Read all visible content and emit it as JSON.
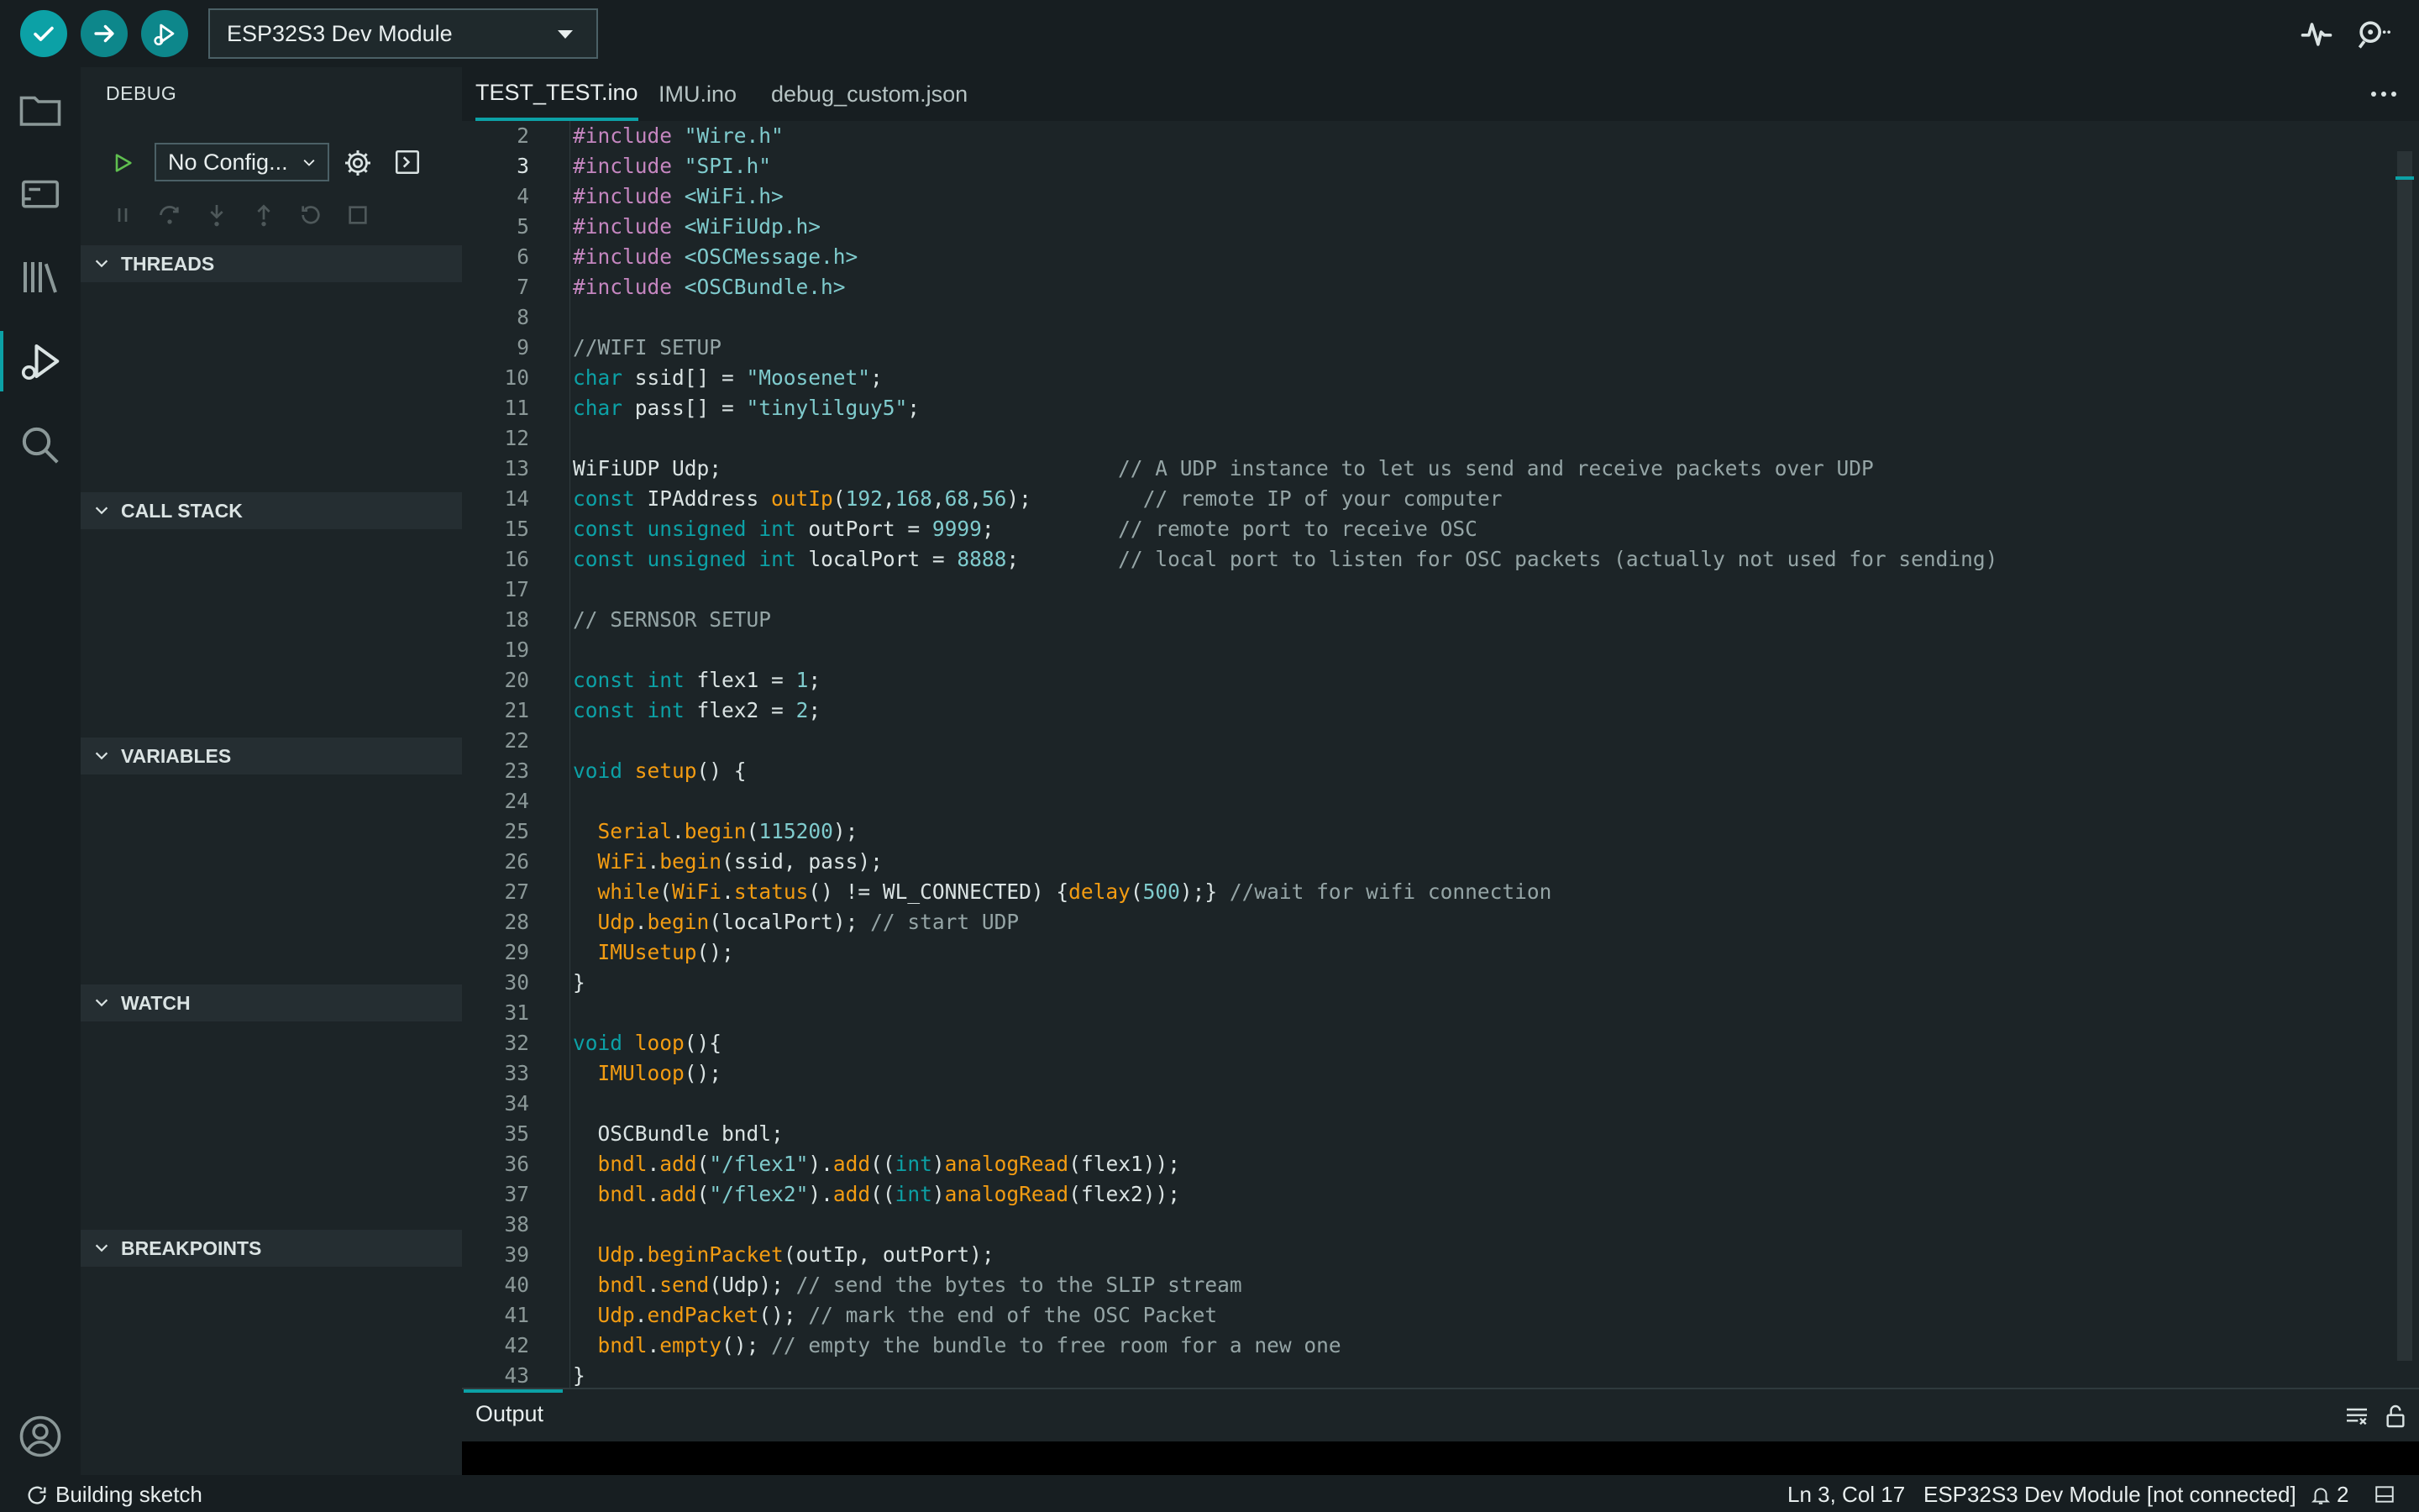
{
  "toolbar": {
    "board": "ESP32S3 Dev Module"
  },
  "sidebar": {
    "title": "DEBUG",
    "config": "No Config...",
    "sections": [
      "THREADS",
      "CALL STACK",
      "VARIABLES",
      "WATCH",
      "BREAKPOINTS"
    ]
  },
  "tabs": [
    "TEST_TEST.ino",
    "IMU.ino",
    "debug_custom.json"
  ],
  "editor": {
    "current_line": 3,
    "lines": [
      {
        "n": "2",
        "html": "<span class=\"p\">#include</span> <span class=\"s\">\"Wire.h\"</span>"
      },
      {
        "n": "3",
        "html": "<span class=\"p\">#include</span> <span class=\"s\">\"SPI.h\"</span>"
      },
      {
        "n": "4",
        "html": "<span class=\"p\">#include</span> <span class=\"s\">&lt;WiFi.h&gt;</span>"
      },
      {
        "n": "5",
        "html": "<span class=\"p\">#include</span> <span class=\"s\">&lt;WiFiUdp.h&gt;</span>"
      },
      {
        "n": "6",
        "html": "<span class=\"p\">#include</span> <span class=\"s\">&lt;OSCMessage.h&gt;</span>"
      },
      {
        "n": "7",
        "html": "<span class=\"p\">#include</span> <span class=\"s\">&lt;OSCBundle.h&gt;</span>"
      },
      {
        "n": "8",
        "html": ""
      },
      {
        "n": "9",
        "html": "<span class=\"c\">//WIFI SETUP</span>"
      },
      {
        "n": "10",
        "html": "<span class=\"k\">char</span> ssid[] = <span class=\"s\">\"Moosenet\"</span>;"
      },
      {
        "n": "11",
        "html": "<span class=\"k\">char</span> pass[] = <span class=\"s\">\"tinylilguy5\"</span>;"
      },
      {
        "n": "12",
        "html": ""
      },
      {
        "n": "13",
        "html": "WiFiUDP Udp;                                <span class=\"c\">// A UDP instance to let us send and receive packets over UDP</span>"
      },
      {
        "n": "14",
        "html": "<span class=\"k\">const</span> IPAddress <span class=\"fo\">outIp</span>(<span class=\"n\">192</span>,<span class=\"n\">168</span>,<span class=\"n\">68</span>,<span class=\"n\">56</span>);         <span class=\"c\">// remote IP of your computer</span>"
      },
      {
        "n": "15",
        "html": "<span class=\"k\">const</span> <span class=\"k\">unsigned</span> <span class=\"k\">int</span> outPort = <span class=\"n\">9999</span>;          <span class=\"c\">// remote port to receive OSC</span>"
      },
      {
        "n": "16",
        "html": "<span class=\"k\">const</span> <span class=\"k\">unsigned</span> <span class=\"k\">int</span> localPort = <span class=\"n\">8888</span>;        <span class=\"c\">// local port to listen for OSC packets (actually not used for sending)</span>"
      },
      {
        "n": "17",
        "html": ""
      },
      {
        "n": "18",
        "html": "<span class=\"c\">// SERNSOR SETUP</span>"
      },
      {
        "n": "19",
        "html": ""
      },
      {
        "n": "20",
        "html": "<span class=\"k\">const</span> <span class=\"k\">int</span> flex1 = <span class=\"n\">1</span>;"
      },
      {
        "n": "21",
        "html": "<span class=\"k\">const</span> <span class=\"k\">int</span> flex2 = <span class=\"n\">2</span>;"
      },
      {
        "n": "22",
        "html": ""
      },
      {
        "n": "23",
        "html": "<span class=\"k\">void</span> <span class=\"fo\">setup</span>() {"
      },
      {
        "n": "24",
        "html": ""
      },
      {
        "n": "25",
        "html": "  <span class=\"fo\">Serial</span>.<span class=\"fo\">begin</span>(<span class=\"n\">115200</span>);"
      },
      {
        "n": "26",
        "html": "  <span class=\"fo\">WiFi</span>.<span class=\"fo\">begin</span>(ssid, pass);"
      },
      {
        "n": "27",
        "html": "  <span class=\"fo\">while</span>(<span class=\"fo\">WiFi</span>.<span class=\"fo\">status</span>() != WL_CONNECTED) {<span class=\"fo\">delay</span>(<span class=\"n\">500</span>);} <span class=\"c\">//wait for wifi connection</span>"
      },
      {
        "n": "28",
        "html": "  <span class=\"fo\">Udp</span>.<span class=\"fo\">begin</span>(localPort); <span class=\"c\">// start UDP</span>"
      },
      {
        "n": "29",
        "html": "  <span class=\"fo\">IMUsetup</span>();"
      },
      {
        "n": "30",
        "html": "}"
      },
      {
        "n": "31",
        "html": ""
      },
      {
        "n": "32",
        "html": "<span class=\"k\">void</span> <span class=\"fo\">loop</span>(){"
      },
      {
        "n": "33",
        "html": "  <span class=\"fo\">IMUloop</span>();"
      },
      {
        "n": "34",
        "html": ""
      },
      {
        "n": "35",
        "html": "  OSCBundle bndl;"
      },
      {
        "n": "36",
        "html": "  <span class=\"fo\">bndl</span>.<span class=\"fo\">add</span>(<span class=\"s\">\"/flex1\"</span>).<span class=\"fo\">add</span>((<span class=\"k\">int</span>)<span class=\"fo\">analogRead</span>(flex1));"
      },
      {
        "n": "37",
        "html": "  <span class=\"fo\">bndl</span>.<span class=\"fo\">add</span>(<span class=\"s\">\"/flex2\"</span>).<span class=\"fo\">add</span>((<span class=\"k\">int</span>)<span class=\"fo\">analogRead</span>(flex2));"
      },
      {
        "n": "38",
        "html": ""
      },
      {
        "n": "39",
        "html": "  <span class=\"fo\">Udp</span>.<span class=\"fo\">beginPacket</span>(outIp, outPort);"
      },
      {
        "n": "40",
        "html": "  <span class=\"fo\">bndl</span>.<span class=\"fo\">send</span>(Udp); <span class=\"c\">// send the bytes to the SLIP stream</span>"
      },
      {
        "n": "41",
        "html": "  <span class=\"fo\">Udp</span>.<span class=\"fo\">endPacket</span>(); <span class=\"c\">// mark the end of the OSC Packet</span>"
      },
      {
        "n": "42",
        "html": "  <span class=\"fo\">bndl</span>.<span class=\"fo\">empty</span>(); <span class=\"c\">// empty the bundle to free room for a new one</span>"
      },
      {
        "n": "43",
        "html": "}"
      }
    ]
  },
  "output": {
    "title": "Output"
  },
  "statusbar": {
    "building": "Building sketch",
    "position": "Ln 3, Col 17",
    "board_status": "ESP32S3 Dev Module [not connected]",
    "notifications": "2"
  },
  "colors": {
    "accent": "#0ca1a6",
    "background": "#171e21",
    "editor_bg": "#1c2427"
  }
}
